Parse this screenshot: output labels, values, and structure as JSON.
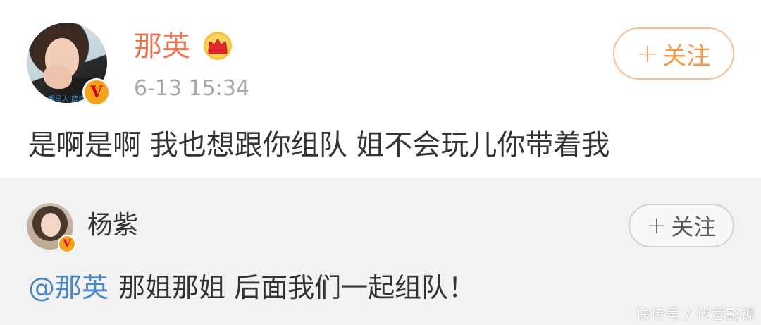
{
  "post": {
    "author": "那英",
    "timestamp": "6-13 15:34",
    "follow_label": "关注",
    "follow_plus": "+",
    "text": "是啊是啊 我也想跟你组队 姐不会玩儿你带着我",
    "verified_badge": "V",
    "avatar_watermark": "明星人 薛泽",
    "icons": {
      "crown": "crown-icon",
      "verified": "verified-badge-icon"
    }
  },
  "reply": {
    "author": "杨紫",
    "follow_label": "关注",
    "follow_plus": "+",
    "mention": "@那英",
    "text": "那姐那姐 后面我们一起组队！",
    "verified_badge": "V"
  },
  "watermark": "快传号 / 代萱影视",
  "colors": {
    "name_orange": "#eb7350",
    "follow_orange": "#f29a4a",
    "mention_blue": "#4a86c5",
    "reply_bg": "#f2f2f2",
    "badge_orange": "#f7a21b",
    "badge_red": "#d8001a"
  }
}
